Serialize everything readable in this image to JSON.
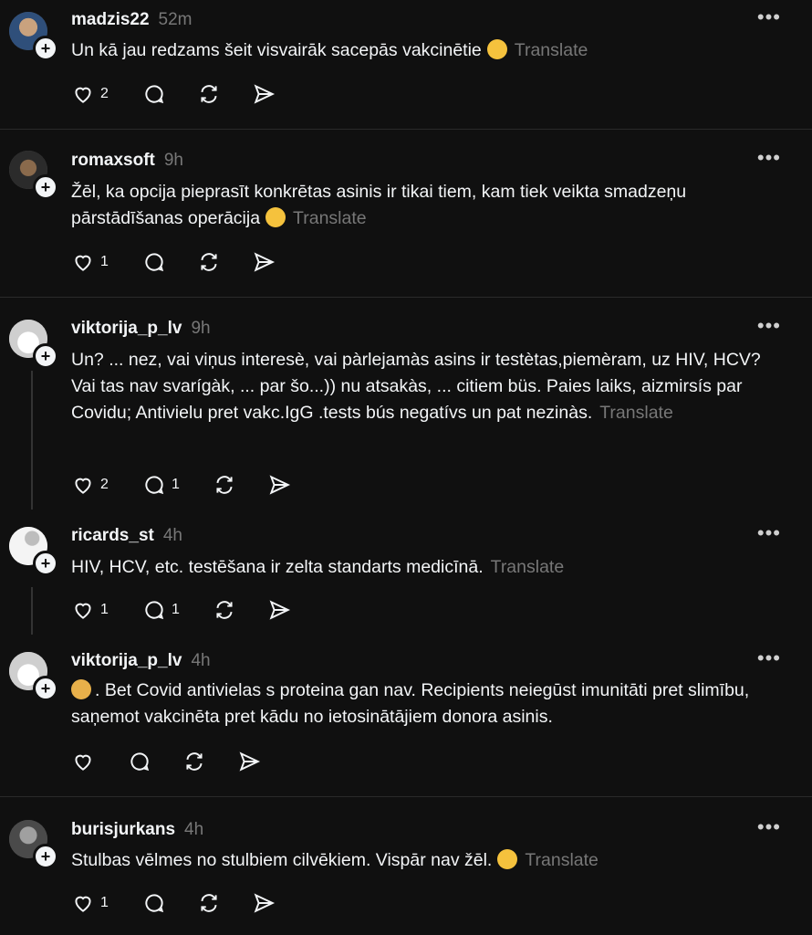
{
  "posts": [
    {
      "username": "madzis22",
      "time": "52m",
      "text": "Un kā jau redzams šeit visvairāk sacepās vakcinētie",
      "emoji": "laughing",
      "translate": "Translate",
      "likes": "2",
      "replies": ""
    },
    {
      "username": "romaxsoft",
      "time": "9h",
      "text": "Žēl, ka opcija pieprasīt konkrētas asinis ir tikai tiem, kam tiek veikta smadzeņu pārstādīšanas operācija",
      "emoji": "dizzy-face",
      "translate": "Translate",
      "likes": "1",
      "replies": ""
    },
    {
      "username": "viktorija_p_lv",
      "time": "9h",
      "text": "Un? ... nez, vai viņus interesè, vai pàrlejamàs asins ir testètas,piemèram, uz HIV, HCV? Vai tas nav svarígàk, ... par šo...)) nu atsakàs, ... citiem büs. Paies laiks, aizmirsís par Covidu; Antivielu pret vakc.IgG .tests bús negatívs un pat nezinàs.",
      "translate": "Translate",
      "likes": "2",
      "replies": "1"
    },
    {
      "username": "ricards_st",
      "time": "4h",
      "text": "HIV, HCV, etc. testēšana ir zelta standarts medicīnā.",
      "translate": "Translate",
      "likes": "1",
      "replies": "1"
    },
    {
      "username": "viktorija_p_lv",
      "time": "4h",
      "text": ". Bet Covid antivielas s proteina gan nav. Recipients neiegūst imunitāti pret slimību, saņemot vakcinēta pret kādu no ietosinātājiem donora asinis.",
      "emoji": "handshake",
      "likes": "",
      "replies": ""
    },
    {
      "username": "burisjurkans",
      "time": "4h",
      "text": "Stulbas vēlmes no stulbiem cilvēkiem. Vispār nav žēl.",
      "emoji": "grinning",
      "translate": "Translate",
      "likes": "1",
      "replies": ""
    }
  ],
  "colors": {
    "background": "#101010",
    "text": "#f3f5f7",
    "muted": "#777777"
  },
  "icons": [
    "heart-icon",
    "comment-icon",
    "repost-icon",
    "share-icon",
    "more-icon",
    "follow-plus-icon"
  ]
}
